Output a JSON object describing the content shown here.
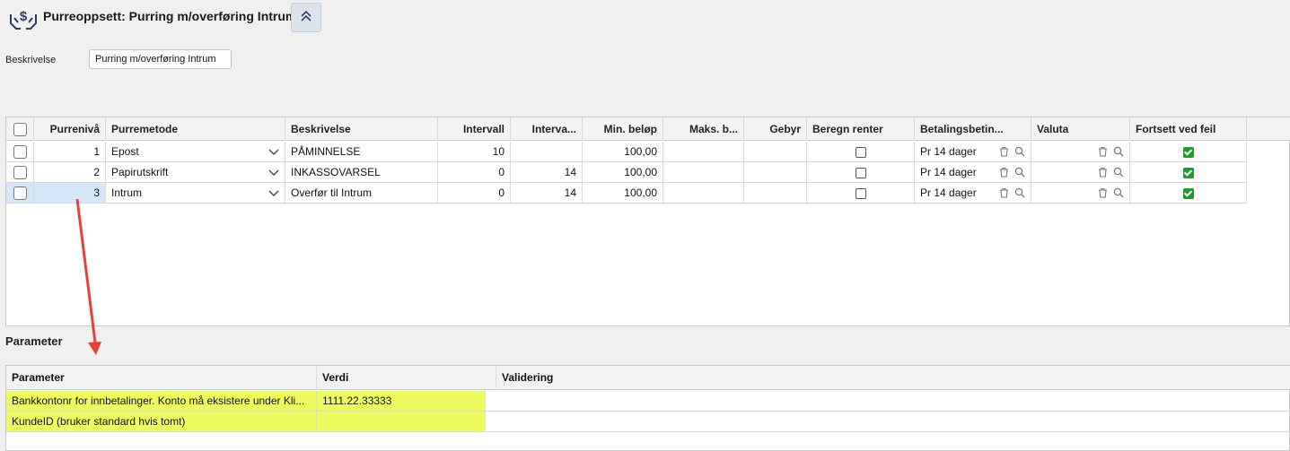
{
  "header": {
    "title": "Purreoppsett: Purring m/overføring Intrum",
    "collapse_icon": "double-chevron-up-icon",
    "logo_icon": "dollar-hands-icon"
  },
  "description": {
    "label": "Beskrivelse",
    "value": "Purring m/overføring Intrum"
  },
  "grid": {
    "columns": [
      "Purrenivå",
      "Purremetode",
      "Beskrivelse",
      "Intervall",
      "Interva...",
      "Min. beløp",
      "Maks. b...",
      "Gebyr",
      "Beregn renter",
      "Betalingsbetin...",
      "Valuta",
      "Fortsett ved feil"
    ],
    "rows": [
      {
        "level": "1",
        "method": "Epost",
        "description": "PÅMINNELSE",
        "interval": "10",
        "interval2": "",
        "min": "100,00",
        "max": "",
        "fee": "",
        "calc_interest": false,
        "payment_terms": "Pr 14 dager",
        "currency": "",
        "continue_on_error": true,
        "selected": false
      },
      {
        "level": "2",
        "method": "Papirutskrift",
        "description": "INKASSOVARSEL",
        "interval": "0",
        "interval2": "14",
        "min": "100,00",
        "max": "",
        "fee": "",
        "calc_interest": false,
        "payment_terms": "Pr 14 dager",
        "currency": "",
        "continue_on_error": true,
        "selected": false
      },
      {
        "level": "3",
        "method": "Intrum",
        "description": "Overfør til Intrum",
        "interval": "0",
        "interval2": "14",
        "min": "100,00",
        "max": "",
        "fee": "",
        "calc_interest": false,
        "payment_terms": "Pr 14 dager",
        "currency": "",
        "continue_on_error": true,
        "selected": true
      }
    ]
  },
  "parameters": {
    "title": "Parameter",
    "columns": [
      "Parameter",
      "Verdi",
      "Validering"
    ],
    "rows": [
      {
        "name": "Bankkontonr for innbetalinger. Konto må eksistere under Kli...",
        "value": "1111.22.33333",
        "validation": "",
        "highlighted": true
      },
      {
        "name": "KundeID (bruker standard hvis tomt)",
        "value": "",
        "validation": "",
        "highlighted": true
      }
    ]
  },
  "colors": {
    "highlight": "#eefb5e",
    "selected_row": "#d5e7f8",
    "check_green": "#1e9b2b",
    "arrow_red": "#e5403a"
  }
}
